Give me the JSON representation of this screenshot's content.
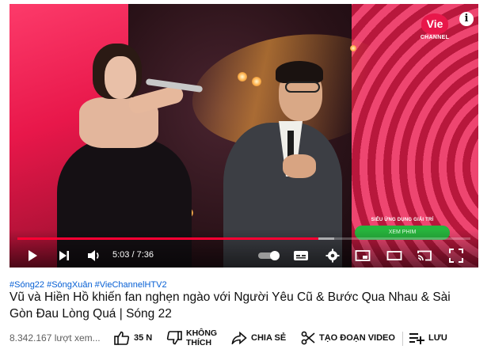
{
  "player": {
    "logo_text": "Vie",
    "logo_sub": "CHANNEL",
    "info_icon": "info-icon",
    "promo_text": "SIÊU ỨNG DỤNG GIẢI TRÍ",
    "promo_button": "XEM PHIM",
    "current_time": "5:03",
    "separator": " / ",
    "duration": "7:36",
    "progress": 0.664,
    "buffered": 0.7,
    "colors": {
      "played": "#ff0033",
      "brand": "#e8174a",
      "promo": "#27b53d"
    },
    "controls": [
      "play-icon",
      "next-icon",
      "volume-icon",
      "autoplay-toggle",
      "subtitles-icon",
      "settings-icon",
      "miniplayer-icon",
      "theater-icon",
      "cast-icon",
      "fullscreen-icon"
    ]
  },
  "video": {
    "hashtags": "#Sóng22 #SóngXuân #VieChannelHTV2",
    "title": "Vũ và Hiền Hồ khiến fan nghẹn ngào với Người Yêu Cũ & Bước Qua Nhau & Sài Gòn Đau Lòng Quá | Sóng 22",
    "views": "8.342.167 lượt xem..."
  },
  "actions": {
    "like_count": "35 N",
    "dislike_line1": "KHÔNG",
    "dislike_line2": "THÍCH",
    "share": "CHIA SẺ",
    "clip": "TẠO ĐOẠN VIDEO",
    "save": "LƯU"
  }
}
